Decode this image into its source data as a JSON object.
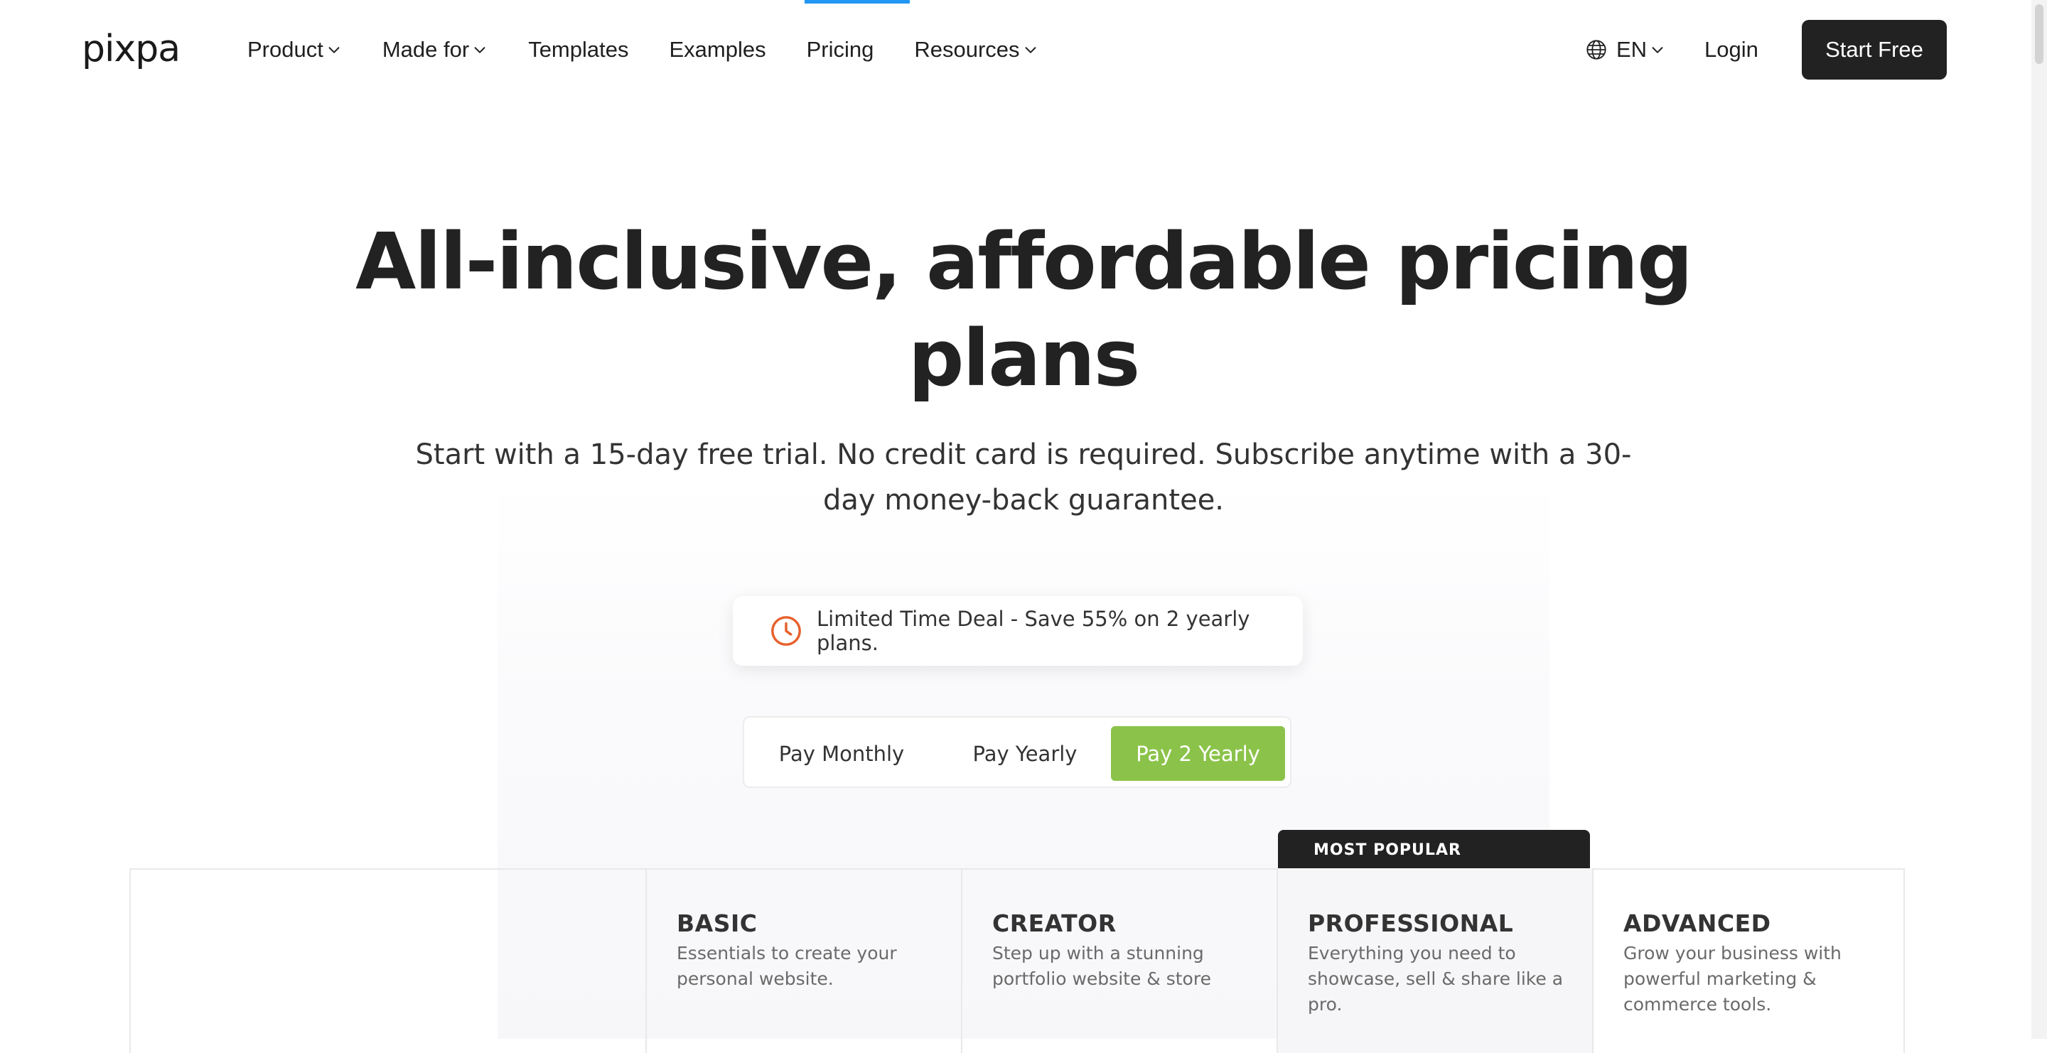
{
  "header": {
    "logo": "pixpa",
    "nav": [
      {
        "label": "Product",
        "dropdown": true
      },
      {
        "label": "Made for",
        "dropdown": true
      },
      {
        "label": "Templates",
        "dropdown": false
      },
      {
        "label": "Examples",
        "dropdown": false
      },
      {
        "label": "Pricing",
        "dropdown": false,
        "active": true
      },
      {
        "label": "Resources",
        "dropdown": true
      }
    ],
    "language": "EN",
    "login": "Login",
    "cta": "Start Free"
  },
  "hero": {
    "title": "All-inclusive, affordable pricing plans",
    "subtitle": "Start with a 15-day free trial. No credit card is required. Subscribe anytime with a 30-day money-back guarantee."
  },
  "deal": {
    "text": "Limited Time Deal - Save 55% on 2 yearly plans.",
    "icon": "clock-icon"
  },
  "billing_toggle": {
    "options": [
      "Pay Monthly",
      "Pay Yearly",
      "Pay 2 Yearly"
    ],
    "selected": "Pay 2 Yearly"
  },
  "plans": {
    "badge": "MOST POPULAR",
    "items": [
      {
        "name": "BASIC",
        "description": "Essentials to create your personal website."
      },
      {
        "name": "CREATOR",
        "description": "Step up with a stunning portfolio website & store"
      },
      {
        "name": "PROFESSIONAL",
        "description": "Everything you need to showcase, sell & share like a pro."
      },
      {
        "name": "ADVANCED",
        "description": "Grow your business with powerful marketing & commerce tools."
      }
    ]
  },
  "colors": {
    "accent_green": "#8bc34a",
    "active_nav_indicator": "#2196f3",
    "dark": "#222222",
    "clock_orange": "#e8602c"
  }
}
